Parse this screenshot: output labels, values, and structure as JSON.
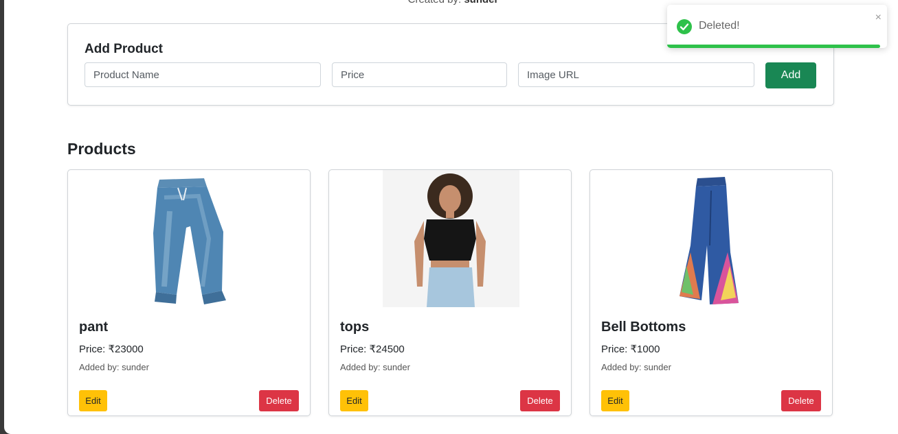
{
  "header": {
    "created_by_label": "Created by:",
    "created_by_name": "sunder"
  },
  "add_product": {
    "title": "Add Product",
    "name_placeholder": "Product Name",
    "price_placeholder": "Price",
    "image_placeholder": "Image URL",
    "add_label": "Add"
  },
  "products_section": {
    "title": "Products",
    "items": [
      {
        "name": "pant",
        "price": "Price: ₹23000",
        "added_by": "Added by: sunder",
        "image": "jeans-pant-image",
        "edit_label": "Edit",
        "delete_label": "Delete"
      },
      {
        "name": "tops",
        "price": "Price: ₹24500",
        "added_by": "Added by: sunder",
        "image": "black-crop-top-model-image",
        "edit_label": "Edit",
        "delete_label": "Delete"
      },
      {
        "name": "Bell Bottoms",
        "price": "Price: ₹1000",
        "added_by": "Added by: sunder",
        "image": "bell-bottom-jeans-image",
        "edit_label": "Edit",
        "delete_label": "Delete"
      }
    ]
  },
  "toast": {
    "message": "Deleted!",
    "close_symbol": "×",
    "icon": "check-circle-icon",
    "progress": 0.97,
    "accent_color": "#2ec14a"
  },
  "colors": {
    "add_button": "#198754",
    "edit_button": "#ffc107",
    "delete_button": "#dc3545"
  }
}
